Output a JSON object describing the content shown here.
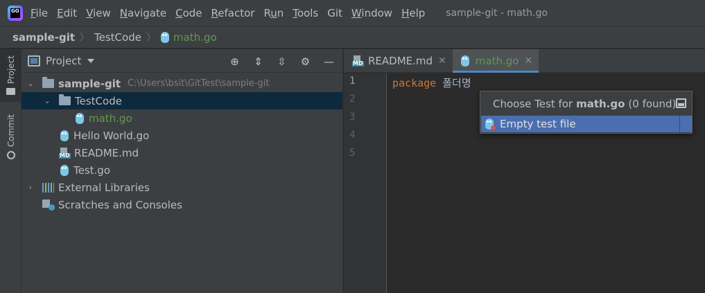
{
  "app": {
    "logo_text": "GO",
    "window_title": "sample-git - math.go"
  },
  "menu": [
    {
      "label": "File",
      "mnemonic": "F",
      "rest": "ile"
    },
    {
      "label": "Edit",
      "mnemonic": "E",
      "rest": "dit"
    },
    {
      "label": "View",
      "mnemonic": "V",
      "rest": "iew"
    },
    {
      "label": "Navigate",
      "mnemonic": "N",
      "rest": "avigate"
    },
    {
      "label": "Code",
      "mnemonic": "C",
      "rest": "ode"
    },
    {
      "label": "Refactor",
      "mnemonic": "R",
      "rest": "efactor"
    },
    {
      "label": "Run",
      "mnemonic": "",
      "pre": "R",
      "u": "u",
      "rest": "n"
    },
    {
      "label": "Tools",
      "mnemonic": "T",
      "rest": "ools"
    },
    {
      "label": "Git",
      "mnemonic": "",
      "rest": "Git"
    },
    {
      "label": "Window",
      "mnemonic": "W",
      "rest": "indow"
    },
    {
      "label": "Help",
      "mnemonic": "H",
      "rest": "elp"
    }
  ],
  "breadcrumb": {
    "project": "sample-git",
    "folder": "TestCode",
    "file": "math.go"
  },
  "stripe": {
    "project_label": "Project",
    "commit_label": "Commit"
  },
  "project_panel": {
    "title": "Project",
    "tools": [
      "locate-icon",
      "expand-all-icon",
      "collapse-all-icon",
      "gear-icon",
      "minimize-icon"
    ],
    "tree": {
      "root": {
        "name": "sample-git",
        "path": "C:\\Users\\bsit\\GitTest\\sample-git"
      },
      "testcode": "TestCode",
      "mathgo": "math.go",
      "hello": "Hello World.go",
      "readme": "README.md",
      "test": "Test.go",
      "external": "External Libraries",
      "scratches": "Scratches and Consoles"
    }
  },
  "editor": {
    "tabs": [
      {
        "label": "README.md",
        "active": false
      },
      {
        "label": "math.go",
        "active": true
      }
    ],
    "line_numbers": [
      "1",
      "2",
      "3",
      "4",
      "5"
    ],
    "code_keyword": "package",
    "code_ident": "폴더명"
  },
  "popup": {
    "title_prefix": "Choose Test for",
    "title_file": "math.go",
    "title_suffix": "(0 found)",
    "item": "Empty test file"
  },
  "colors": {
    "accent": "#4b6eaf",
    "selection": "#0d293e",
    "keyword": "#cc7832",
    "green_file": "#629755"
  }
}
